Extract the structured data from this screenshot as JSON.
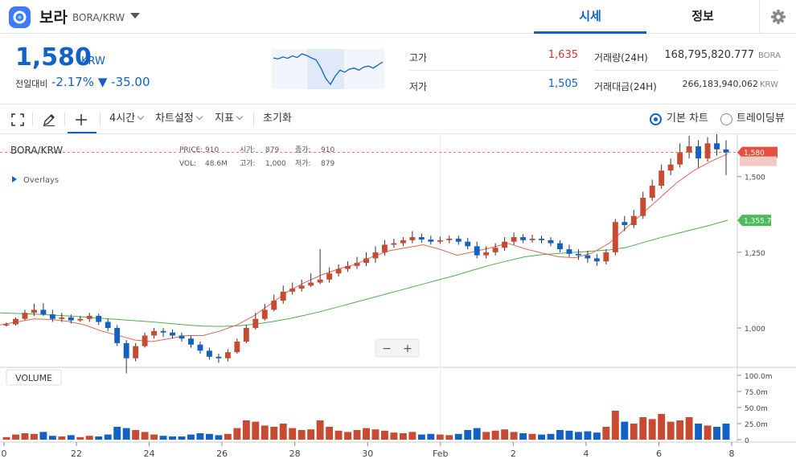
{
  "header": {
    "coin_name": "보라",
    "pair": "BORA/KRW",
    "tabs": [
      {
        "label": "시세",
        "active": true
      },
      {
        "label": "정보",
        "active": false
      }
    ],
    "icons": {
      "logo": "bora-logo-icon",
      "dropdown": "chevron-down-icon",
      "settings": "gear-icon"
    }
  },
  "summary": {
    "price": "1,580",
    "currency": "KRW",
    "change_label": "전일대비",
    "change_rate": "-2.17%",
    "change_value": "▼ -35.00",
    "high_label": "고가",
    "high_value": "1,635",
    "low_label": "저가",
    "low_value": "1,505",
    "volume_label": "거래량(24H)",
    "volume_value": "168,795,820.777",
    "volume_unit": "BORA",
    "amount_label": "거래대금(24H)",
    "amount_value": "266,183,940,062",
    "amount_unit": "KRW",
    "spark_values": [
      1700,
      1695,
      1705,
      1698,
      1710,
      1702,
      1720,
      1712,
      1700,
      1690,
      1650,
      1600,
      1570,
      1610,
      1640,
      1630,
      1645,
      1650,
      1640,
      1655,
      1660,
      1650,
      1665,
      1680
    ]
  },
  "toolbar": {
    "interval": "4시간",
    "chart_settings": "차트설정",
    "indicators": "지표",
    "reset": "초기화",
    "basic_chart": "기본 차트",
    "tradingview": "트레이딩뷰",
    "icons": {
      "fullscreen": "fullscreen-icon",
      "draw": "pencil-icon",
      "crosshair": "plus-icon"
    }
  },
  "colors": {
    "accent": "#1261c4",
    "up": "#c84a31",
    "down": "#1261c4",
    "ma_short": "#e0665a",
    "ma_long": "#4caf50",
    "last_badge": "#e15241",
    "ma_badge": "#4cbb5a"
  },
  "legend": {
    "symbol": "BORA/KRW",
    "overlays": "Overlays",
    "price_label": "PRICE:",
    "price": "910",
    "open_label": "시가:",
    "open": "879",
    "close_label": "종가:",
    "close": "910",
    "vol_label": "VOL:",
    "vol": "48.6M",
    "high_label": "고가:",
    "high": "1,000",
    "low_label": "저가:",
    "low": "879"
  },
  "zoom": {
    "minus": "−",
    "plus": "+"
  },
  "volume_pane_label": "VOLUME",
  "chart_data": {
    "type": "candlestick",
    "x_ticks": [
      "0",
      "22",
      "24",
      "26",
      "28",
      "30",
      "Feb",
      "2",
      "4",
      "6",
      "8"
    ],
    "y_ticks": [
      "1,500",
      "1,250",
      "1,000"
    ],
    "y_range": [
      870,
      1640
    ],
    "volume_ticks": [
      "100.0m",
      "75.0m",
      "50.0m",
      "25.0m",
      "0"
    ],
    "volume_range": [
      0,
      105
    ],
    "last_price": "1,580",
    "ma_badge_value": "1,355.7",
    "ma_long": [
      1050,
      1048,
      1046,
      1043,
      1040,
      1036,
      1032,
      1028,
      1024,
      1020,
      1015,
      1010,
      1006,
      1005,
      1007,
      1012,
      1020,
      1030,
      1042,
      1055,
      1070,
      1085,
      1100,
      1115,
      1130,
      1145,
      1160,
      1175,
      1192,
      1208,
      1222,
      1235,
      1242,
      1246,
      1250,
      1254,
      1258,
      1266,
      1282,
      1298,
      1312,
      1326,
      1340,
      1356
    ],
    "ma_short": [
      1010,
      1020,
      1030,
      1028,
      1022,
      1010,
      990,
      975,
      960,
      955,
      965,
      975,
      975,
      990,
      1010,
      1040,
      1080,
      1120,
      1150,
      1175,
      1195,
      1210,
      1235,
      1255,
      1265,
      1275,
      1260,
      1240,
      1252,
      1265,
      1280,
      1262,
      1248,
      1235,
      1232,
      1248,
      1280,
      1330,
      1380,
      1430,
      1480,
      1520,
      1550,
      1575
    ],
    "candles": [
      [
        1010,
        1012,
        1018,
        1005,
        4
      ],
      [
        1012,
        1030,
        1035,
        1008,
        8
      ],
      [
        1030,
        1050,
        1060,
        1025,
        10
      ],
      [
        1050,
        1060,
        1080,
        1040,
        9
      ],
      [
        1060,
        1045,
        1082,
        1040,
        12
      ],
      [
        1045,
        1030,
        1060,
        1020,
        6
      ],
      [
        1030,
        1035,
        1050,
        1020,
        5
      ],
      [
        1035,
        1025,
        1045,
        1015,
        7
      ],
      [
        1025,
        1030,
        1040,
        1020,
        4
      ],
      [
        1030,
        1040,
        1050,
        1020,
        6
      ],
      [
        1040,
        1020,
        1048,
        1010,
        5
      ],
      [
        1020,
        1000,
        1030,
        990,
        8
      ],
      [
        1000,
        950,
        1010,
        940,
        20
      ],
      [
        950,
        900,
        960,
        850,
        18
      ],
      [
        900,
        940,
        950,
        890,
        15
      ],
      [
        940,
        975,
        985,
        935,
        12
      ],
      [
        975,
        990,
        1000,
        965,
        8
      ],
      [
        990,
        985,
        1000,
        970,
        6
      ],
      [
        985,
        975,
        995,
        965,
        5
      ],
      [
        975,
        965,
        985,
        955,
        5
      ],
      [
        965,
        945,
        975,
        935,
        8
      ],
      [
        945,
        925,
        955,
        915,
        10
      ],
      [
        925,
        905,
        935,
        895,
        9
      ],
      [
        905,
        900,
        915,
        885,
        7
      ],
      [
        900,
        920,
        930,
        890,
        9
      ],
      [
        920,
        955,
        965,
        915,
        18
      ],
      [
        955,
        1000,
        1010,
        950,
        30
      ],
      [
        1000,
        1030,
        1050,
        995,
        28
      ],
      [
        1030,
        1060,
        1080,
        1025,
        22
      ],
      [
        1060,
        1090,
        1110,
        1055,
        20
      ],
      [
        1090,
        1120,
        1140,
        1080,
        25
      ],
      [
        1120,
        1130,
        1150,
        1110,
        18
      ],
      [
        1130,
        1140,
        1160,
        1120,
        15
      ],
      [
        1140,
        1150,
        1180,
        1135,
        16
      ],
      [
        1150,
        1160,
        1260,
        1145,
        30
      ],
      [
        1160,
        1180,
        1200,
        1150,
        20
      ],
      [
        1180,
        1195,
        1210,
        1170,
        14
      ],
      [
        1195,
        1205,
        1220,
        1185,
        12
      ],
      [
        1205,
        1215,
        1235,
        1195,
        15
      ],
      [
        1215,
        1230,
        1250,
        1205,
        18
      ],
      [
        1230,
        1250,
        1270,
        1215,
        16
      ],
      [
        1250,
        1275,
        1290,
        1240,
        14
      ],
      [
        1275,
        1280,
        1295,
        1265,
        11
      ],
      [
        1280,
        1290,
        1300,
        1270,
        10
      ],
      [
        1290,
        1300,
        1320,
        1280,
        12
      ],
      [
        1300,
        1292,
        1312,
        1282,
        8
      ],
      [
        1292,
        1285,
        1305,
        1275,
        9
      ],
      [
        1285,
        1290,
        1302,
        1278,
        8
      ],
      [
        1290,
        1295,
        1305,
        1280,
        7
      ],
      [
        1295,
        1285,
        1305,
        1275,
        9
      ],
      [
        1285,
        1270,
        1298,
        1260,
        15
      ],
      [
        1270,
        1240,
        1285,
        1230,
        18
      ],
      [
        1240,
        1250,
        1270,
        1230,
        12
      ],
      [
        1250,
        1265,
        1280,
        1240,
        14
      ],
      [
        1265,
        1285,
        1300,
        1255,
        16
      ],
      [
        1285,
        1300,
        1315,
        1275,
        12
      ],
      [
        1300,
        1290,
        1310,
        1280,
        10
      ],
      [
        1290,
        1295,
        1308,
        1282,
        9
      ],
      [
        1295,
        1290,
        1305,
        1280,
        8
      ],
      [
        1290,
        1280,
        1300,
        1270,
        9
      ],
      [
        1280,
        1260,
        1290,
        1250,
        15
      ],
      [
        1260,
        1245,
        1275,
        1235,
        14
      ],
      [
        1245,
        1240,
        1260,
        1225,
        12
      ],
      [
        1240,
        1230,
        1255,
        1215,
        13
      ],
      [
        1230,
        1220,
        1245,
        1205,
        11
      ],
      [
        1220,
        1250,
        1260,
        1210,
        20
      ],
      [
        1250,
        1350,
        1360,
        1240,
        45
      ],
      [
        1350,
        1340,
        1370,
        1320,
        28
      ],
      [
        1340,
        1370,
        1390,
        1330,
        25
      ],
      [
        1370,
        1430,
        1450,
        1360,
        35
      ],
      [
        1430,
        1470,
        1490,
        1420,
        32
      ],
      [
        1470,
        1520,
        1540,
        1460,
        40
      ],
      [
        1520,
        1540,
        1560,
        1505,
        28
      ],
      [
        1540,
        1580,
        1610,
        1530,
        30
      ],
      [
        1580,
        1600,
        1635,
        1560,
        35
      ],
      [
        1600,
        1560,
        1620,
        1530,
        25
      ],
      [
        1560,
        1610,
        1630,
        1550,
        22
      ],
      [
        1610,
        1590,
        1640,
        1570,
        20
      ],
      [
        1590,
        1580,
        1620,
        1505,
        25
      ]
    ]
  }
}
